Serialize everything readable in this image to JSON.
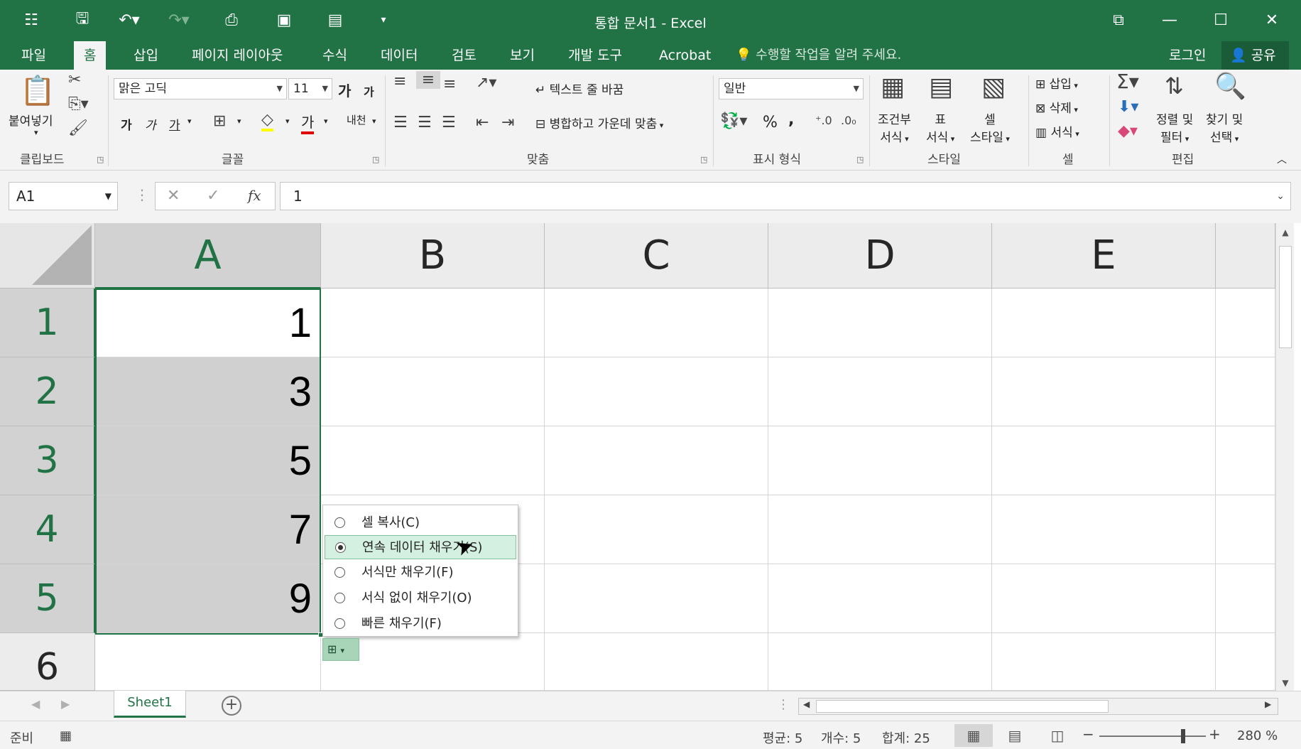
{
  "window": {
    "title": "통합 문서1 - Excel"
  },
  "qat": {
    "save_icon": "save-icon",
    "undo_icon": "undo-icon",
    "redo_icon": "redo-icon"
  },
  "tabs": [
    {
      "label": "파일"
    },
    {
      "label": "홈"
    },
    {
      "label": "삽입"
    },
    {
      "label": "페이지 레이아웃"
    },
    {
      "label": "수식"
    },
    {
      "label": "데이터"
    },
    {
      "label": "검토"
    },
    {
      "label": "보기"
    },
    {
      "label": "개발 도구"
    },
    {
      "label": "Acrobat"
    }
  ],
  "tell_me": "수행할 작업을 알려 주세요.",
  "login": "로그인",
  "share": "공유",
  "ribbon": {
    "clipboard": {
      "label": "클립보드",
      "paste": "붙여넣기"
    },
    "font": {
      "label": "글꼴",
      "font_name": "맑은 고딕",
      "font_size": "11",
      "grow": "가",
      "shrink": "가",
      "bold": "가",
      "italic": "가",
      "underline": "가",
      "font_color": "가",
      "phonetic": "내천"
    },
    "alignment": {
      "label": "맞춤",
      "wrap_text": "텍스트 줄 바꿈",
      "merge_center": "병합하고 가운데 맞춤"
    },
    "number": {
      "label": "표시 형식",
      "format": "일반",
      "percent": "%",
      "comma": ","
    },
    "styles": {
      "label": "스타일",
      "conditional": [
        "조건부",
        "서식"
      ],
      "table": [
        "표",
        "서식"
      ],
      "cell": [
        "셀",
        "스타일"
      ]
    },
    "cells": {
      "label": "셀",
      "insert": "삽입",
      "delete": "삭제",
      "format": "서식"
    },
    "editing": {
      "label": "편집",
      "sort": [
        "정렬 및",
        "필터"
      ],
      "find": [
        "찾기 및",
        "선택"
      ]
    }
  },
  "formula_bar": {
    "name_box": "A1",
    "fx": "fx",
    "value": "1"
  },
  "columns": [
    "A",
    "B",
    "C",
    "D",
    "E"
  ],
  "rows": [
    {
      "num": "1",
      "a": "1"
    },
    {
      "num": "2",
      "a": "3"
    },
    {
      "num": "3",
      "a": "5"
    },
    {
      "num": "4",
      "a": "7"
    },
    {
      "num": "5",
      "a": "9"
    },
    {
      "num": "6",
      "a": ""
    }
  ],
  "autofill_menu": [
    {
      "label": "셀 복사(C)"
    },
    {
      "label": "연속 데이터 채우기(S)"
    },
    {
      "label": "서식만 채우기(F)"
    },
    {
      "label": "서식 없이 채우기(O)"
    },
    {
      "label": "빠른 채우기(F)"
    }
  ],
  "sheet": {
    "name": "Sheet1"
  },
  "status": {
    "ready": "준비",
    "average": "평균: 5",
    "count": "개수: 5",
    "sum": "합계: 25",
    "zoom": "280 %"
  },
  "colors": {
    "accent": "#217346",
    "selection": "#d0d0d0",
    "highlight": "#d3f0e0"
  }
}
